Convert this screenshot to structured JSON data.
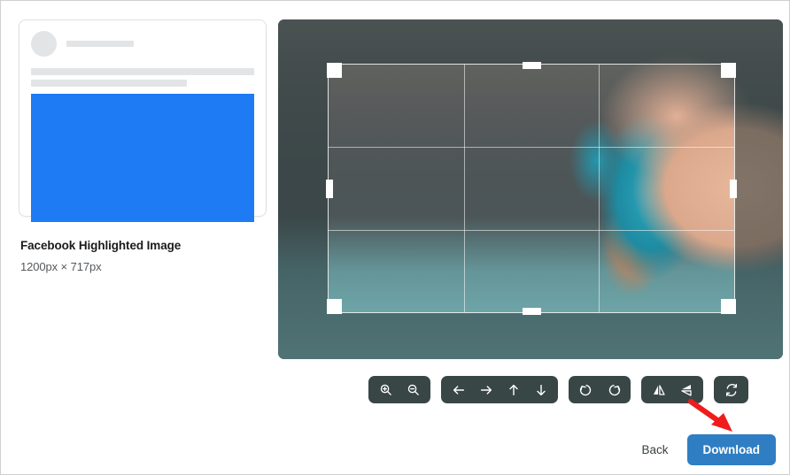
{
  "preview": {
    "card_name": "facebook-post-skeleton",
    "image_placeholder_color": "#1f7bf4",
    "title": "Facebook Highlighted Image",
    "dimensions": "1200px × 717px"
  },
  "canvas": {
    "name": "image-crop-canvas",
    "crop": {
      "grid": "rule-of-thirds",
      "handles": [
        "top-left",
        "top-center",
        "top-right",
        "middle-left",
        "middle-right",
        "bottom-left",
        "bottom-center",
        "bottom-right"
      ]
    }
  },
  "toolbar": {
    "groups": [
      {
        "name": "zoom-group",
        "buttons": [
          {
            "icon": "zoom-in-icon",
            "label": "Zoom In"
          },
          {
            "icon": "zoom-out-icon",
            "label": "Zoom Out"
          }
        ]
      },
      {
        "name": "move-group",
        "buttons": [
          {
            "icon": "arrow-left-icon",
            "label": "Move Left"
          },
          {
            "icon": "arrow-right-icon",
            "label": "Move Right"
          },
          {
            "icon": "arrow-up-icon",
            "label": "Move Up"
          },
          {
            "icon": "arrow-down-icon",
            "label": "Move Down"
          }
        ]
      },
      {
        "name": "rotate-group",
        "buttons": [
          {
            "icon": "rotate-left-icon",
            "label": "Rotate Left"
          },
          {
            "icon": "rotate-right-icon",
            "label": "Rotate Right"
          }
        ]
      },
      {
        "name": "flip-group",
        "buttons": [
          {
            "icon": "flip-horizontal-icon",
            "label": "Flip Horizontal"
          },
          {
            "icon": "flip-vertical-icon",
            "label": "Flip Vertical"
          }
        ]
      },
      {
        "name": "reset-group",
        "buttons": [
          {
            "icon": "reset-icon",
            "label": "Reset"
          }
        ]
      }
    ],
    "button_bg": "#394646"
  },
  "footer": {
    "back_label": "Back",
    "download_label": "Download",
    "download_color": "#2f7ec3"
  },
  "annotation": {
    "arrow_color": "#ee1c1c",
    "points_to": "download-button"
  }
}
